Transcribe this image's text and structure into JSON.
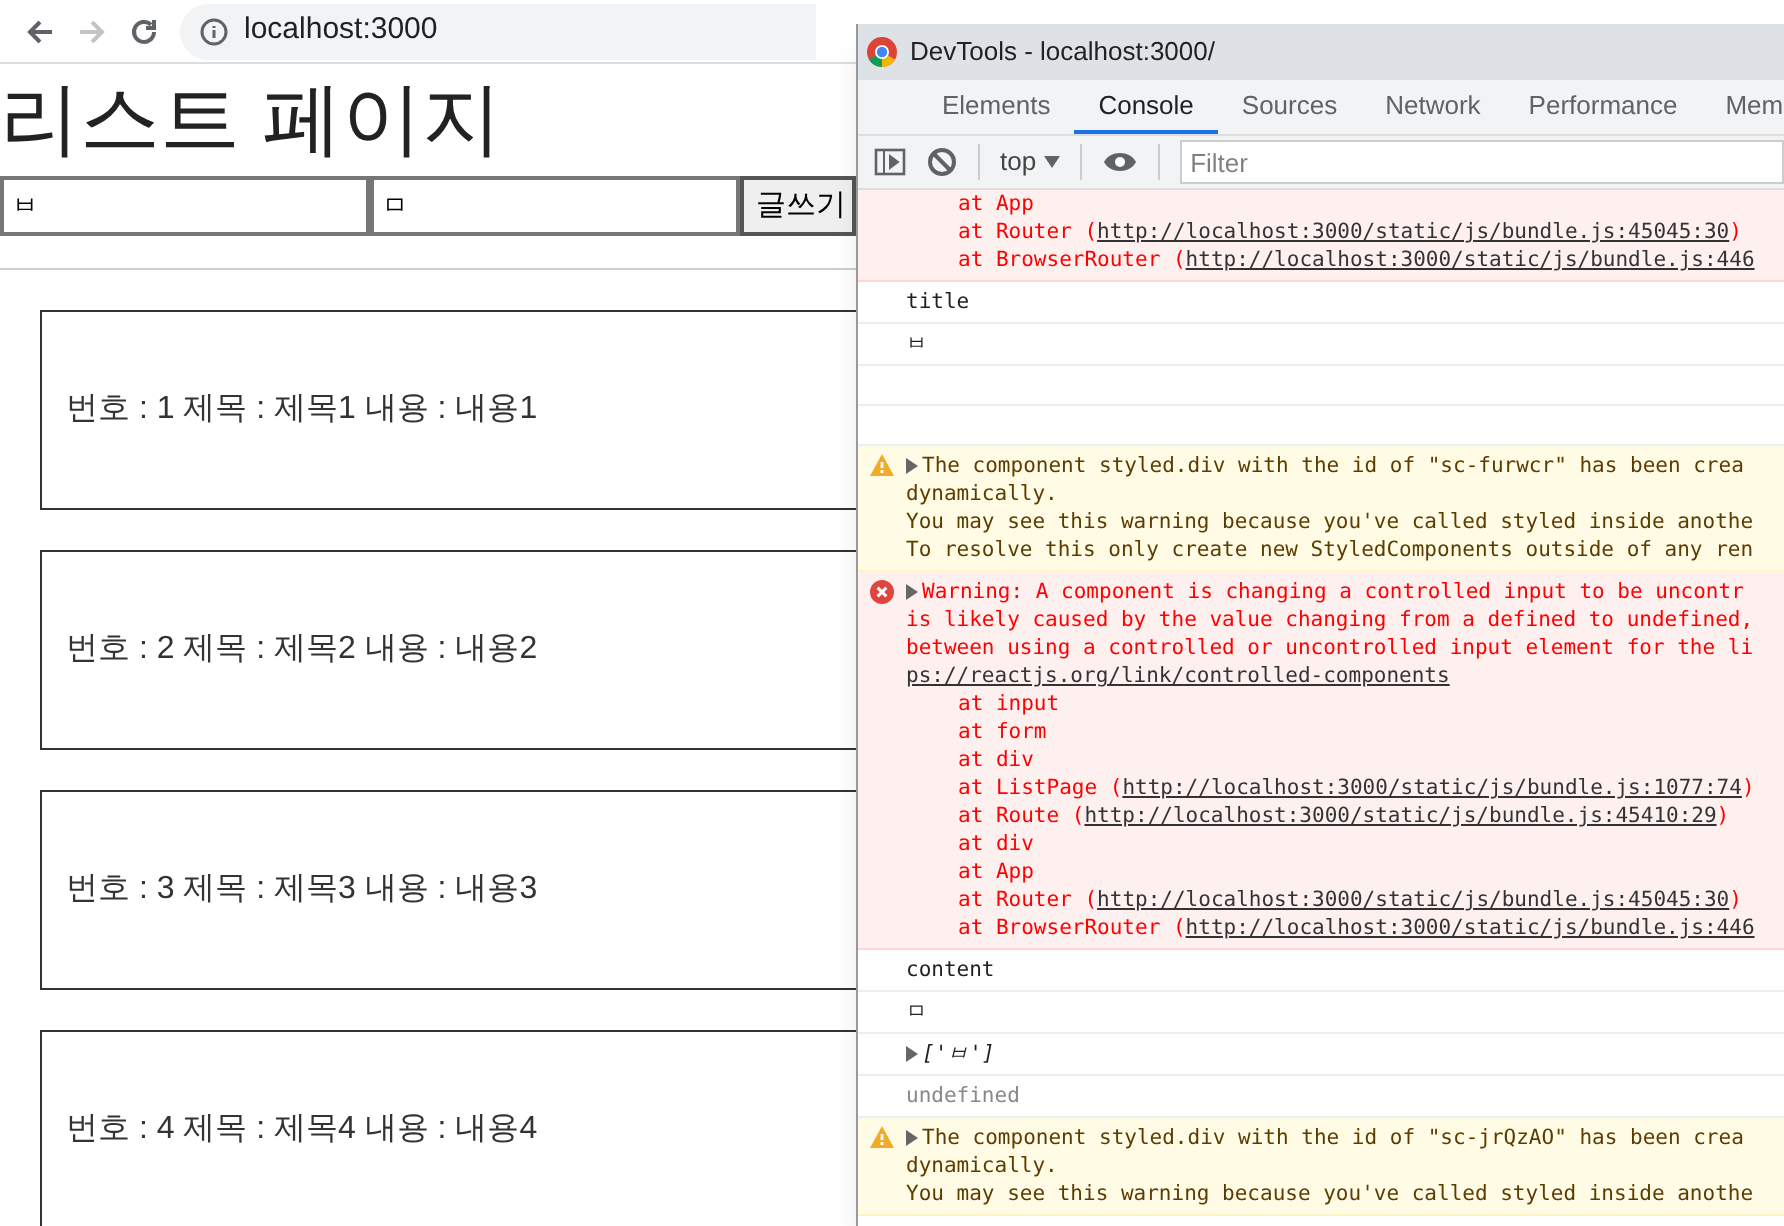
{
  "browser": {
    "address": "localhost:3000",
    "back_disabled": false,
    "forward_disabled": true
  },
  "page": {
    "heading": "리스트 페이지",
    "title_input": "ㅂ",
    "content_input": "ㅁ",
    "submit_button": "글쓰기",
    "posts": [
      {
        "text": "번호 : 1 제목 : 제목1 내용 : 내용1"
      },
      {
        "text": "번호 : 2 제목 : 제목2 내용 : 내용2"
      },
      {
        "text": "번호 : 3 제목 : 제목3 내용 : 내용3"
      },
      {
        "text": "번호 : 4 제목 : 제목4 내용 : 내용4"
      }
    ]
  },
  "devtools": {
    "title": "DevTools - localhost:3000/",
    "tabs": [
      {
        "label": "Elements",
        "selected": false
      },
      {
        "label": "Console",
        "selected": true
      },
      {
        "label": "Sources",
        "selected": false
      },
      {
        "label": "Network",
        "selected": false
      },
      {
        "label": "Performance",
        "selected": false
      },
      {
        "label": "Mem",
        "selected": false
      }
    ],
    "context": "top",
    "filter_placeholder": "Filter",
    "messages": [
      {
        "kind": "error",
        "stack": [
          {
            "text": "at App"
          },
          {
            "text": "at Router (",
            "link": "http://localhost:3000/static/js/bundle.js:45045:30",
            "after": ")"
          },
          {
            "text": "at BrowserRouter (",
            "link": "http://localhost:3000/static/js/bundle.js:446"
          }
        ]
      },
      {
        "kind": "log",
        "lines": [
          "title"
        ]
      },
      {
        "kind": "log",
        "lines": [
          "ㅂ"
        ]
      },
      {
        "kind": "blank"
      },
      {
        "kind": "blank"
      },
      {
        "kind": "warning",
        "lines": [
          "The component styled.div with the id of \"sc-furwcr\" has been crea",
          "dynamically.",
          "You may see this warning because you've called styled inside anothe",
          "To resolve this only create new StyledComponents outside of any ren"
        ]
      },
      {
        "kind": "error",
        "lines": [
          "Warning: A component is changing a controlled input to be uncontr",
          "is likely caused by the value changing from a defined to undefined,",
          "between using a controlled or uncontrolled input element for the li"
        ],
        "link": "ps://reactjs.org/link/controlled-components",
        "stack": [
          {
            "text": "at input"
          },
          {
            "text": "at form"
          },
          {
            "text": "at div"
          },
          {
            "text": "at ListPage (",
            "link": "http://localhost:3000/static/js/bundle.js:1077:74",
            "after": ")"
          },
          {
            "text": "at Route (",
            "link": "http://localhost:3000/static/js/bundle.js:45410:29",
            "after": ")"
          },
          {
            "text": "at div"
          },
          {
            "text": "at App"
          },
          {
            "text": "at Router (",
            "link": "http://localhost:3000/static/js/bundle.js:45045:30",
            "after": ")"
          },
          {
            "text": "at BrowserRouter (",
            "link": "http://localhost:3000/static/js/bundle.js:446"
          }
        ]
      },
      {
        "kind": "log",
        "lines": [
          "content"
        ]
      },
      {
        "kind": "log",
        "lines": [
          "ㅁ"
        ]
      },
      {
        "kind": "array",
        "lines": [
          "['ㅂ']"
        ]
      },
      {
        "kind": "undefined",
        "lines": [
          "undefined"
        ]
      },
      {
        "kind": "warning",
        "lines": [
          "The component styled.div with the id of \"sc-jrQzAO\" has been crea",
          "dynamically.",
          "You may see this warning because you've called styled inside anothe"
        ]
      }
    ]
  }
}
